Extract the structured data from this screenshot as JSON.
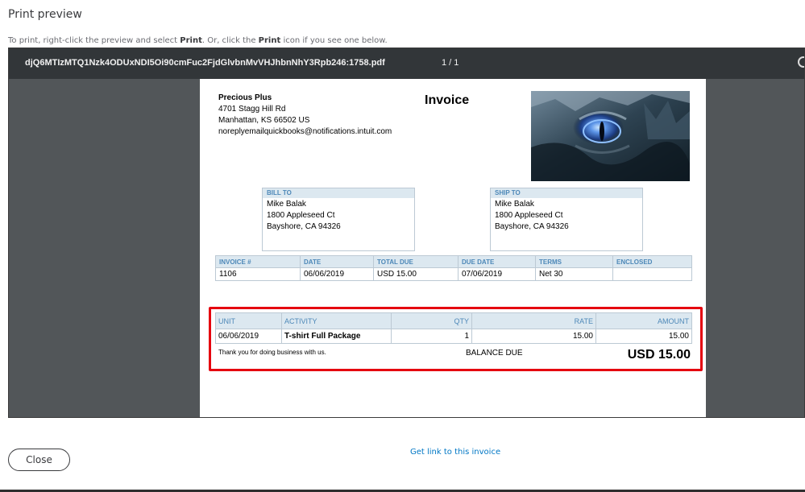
{
  "dialog": {
    "title": "Print preview",
    "instructions": {
      "part1": "To print, right-click the preview and select ",
      "bold1": "Print",
      "part2": ". Or, click the ",
      "bold2": "Print",
      "part3": " icon if you see one below."
    },
    "close_label": "Close",
    "get_link_label": "Get link to this invoice"
  },
  "viewer": {
    "file_name": "djQ6MTIzMTQ1Nzk4ODUxNDI5Oi90cmFuc2FjdGlvbnMvVHJhbnNhY3Rpb246:1758.pdf",
    "page_count": "1 / 1"
  },
  "invoice": {
    "heading": "Invoice",
    "company": {
      "name": "Precious Plus",
      "address1": "4701 Stagg Hill Rd",
      "address2": "Manhattan, KS  66502 US",
      "email": "noreplyemailquickbooks@notifications.intuit.com"
    },
    "bill_to": {
      "label": "BILL TO",
      "name": "Mike Balak",
      "address1": "1800 Appleseed Ct",
      "address2": "Bayshore, CA  94326"
    },
    "ship_to": {
      "label": "SHIP TO",
      "name": "Mike Balak",
      "address1": "1800 Appleseed Ct",
      "address2": "Bayshore, CA  94326"
    },
    "meta_headers": [
      "INVOICE #",
      "DATE",
      "TOTAL DUE",
      "DUE DATE",
      "TERMS",
      "ENCLOSED"
    ],
    "meta_values": [
      "1106",
      "06/06/2019",
      "USD 15.00",
      "07/06/2019",
      "Net 30",
      ""
    ],
    "item_headers": [
      "UNIT",
      "ACTIVITY",
      "QTY",
      "RATE",
      "AMOUNT"
    ],
    "items": [
      {
        "unit": "06/06/2019",
        "activity": "T-shirt Full Package",
        "qty": "1",
        "rate": "15.00",
        "amount": "15.00"
      }
    ],
    "thanks": "Thank you for doing business with us.",
    "balance_label": "BALANCE DUE",
    "balance_value": "USD 15.00"
  },
  "colors": {
    "viewer_background": "#525659",
    "toolbar": "#323639",
    "header_fill": "#dce8f0",
    "header_text": "#4d88b8",
    "highlight": "#e5000f",
    "link": "#0077c5"
  }
}
